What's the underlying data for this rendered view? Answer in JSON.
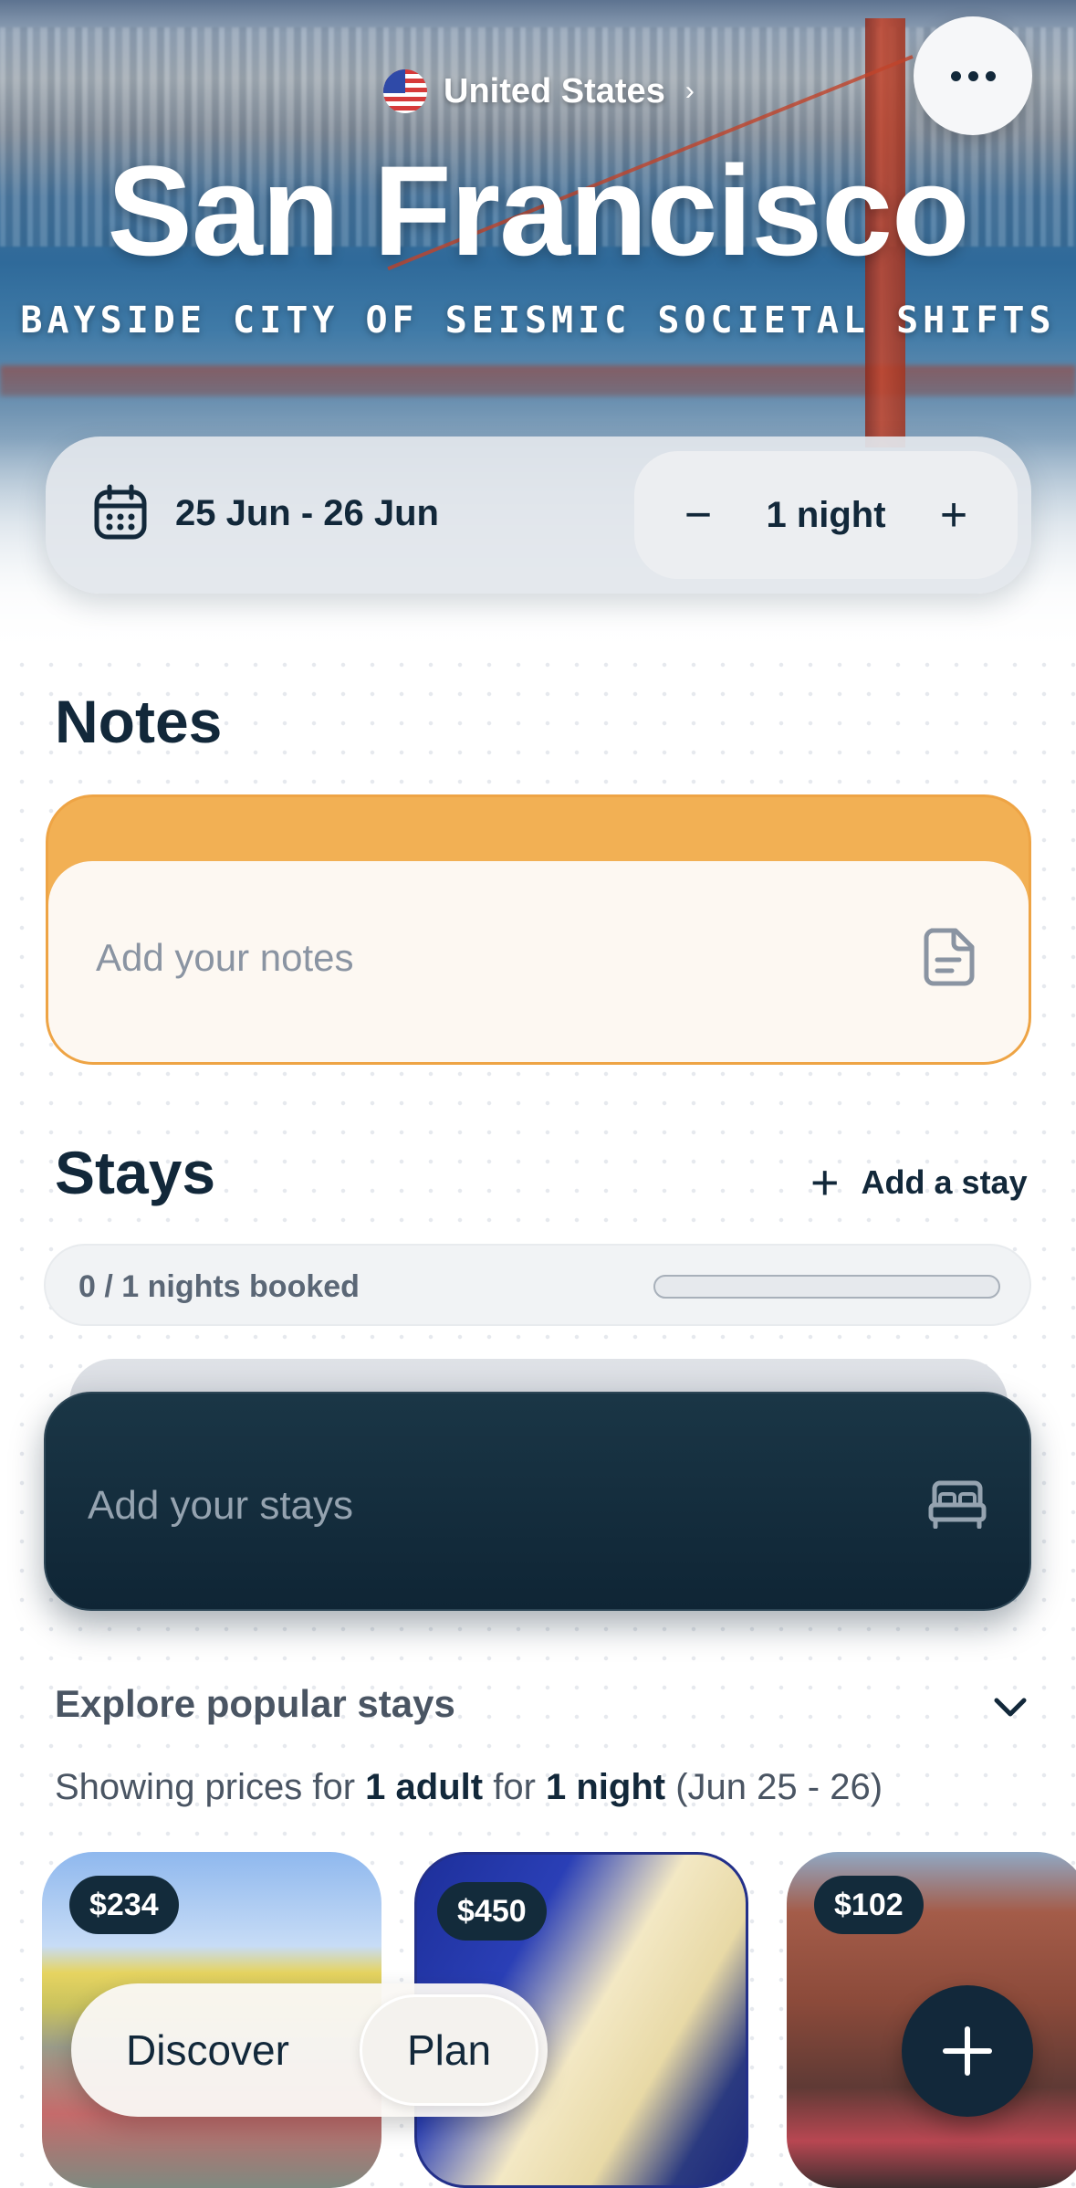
{
  "header": {
    "country": "United States",
    "city": "San Francisco",
    "tagline": "BAYSIDE CITY OF SEISMIC SOCIETAL SHIFTS"
  },
  "dates": {
    "range": "25 Jun - 26 Jun",
    "nights": "1 night",
    "decrement_label": "−",
    "increment_label": "+"
  },
  "notes": {
    "title": "Notes",
    "placeholder": "Add your notes"
  },
  "stays": {
    "title": "Stays",
    "add_label": "Add a stay",
    "booked_text": "0 / 1 nights booked",
    "booked_fraction": 0,
    "placeholder": "Add your stays"
  },
  "explore": {
    "title": "Explore popular stays",
    "showing_prefix": "Showing prices for",
    "adults": "1 adult",
    "for_word": "for",
    "nights": "1 night",
    "date_range": "(Jun 25 - 26)",
    "hotels": [
      {
        "price": "$234"
      },
      {
        "price": "$450"
      },
      {
        "price": "$102"
      }
    ]
  },
  "bottom_nav": {
    "discover": "Discover",
    "plan": "Plan"
  },
  "colors": {
    "navy": "#12283a",
    "notes_accent": "#f2b054",
    "stays_card": "#0f2535"
  }
}
